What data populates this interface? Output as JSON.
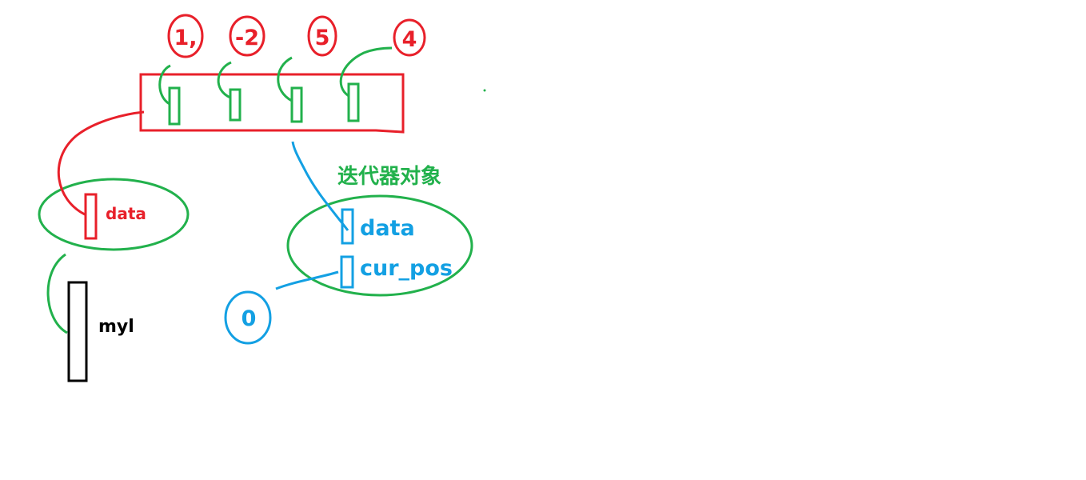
{
  "colors": {
    "red": "#e8202a",
    "green": "#22b14c",
    "blue": "#13a0e3",
    "black": "#000000"
  },
  "list_values": [
    "1,",
    "-2",
    "5",
    "4"
  ],
  "myl_label": "myl",
  "list_ref_label": "data",
  "iterator": {
    "title": "迭代器对象",
    "data_label": "data",
    "cur_pos_label": "cur_pos",
    "cur_pos_value": "0"
  }
}
